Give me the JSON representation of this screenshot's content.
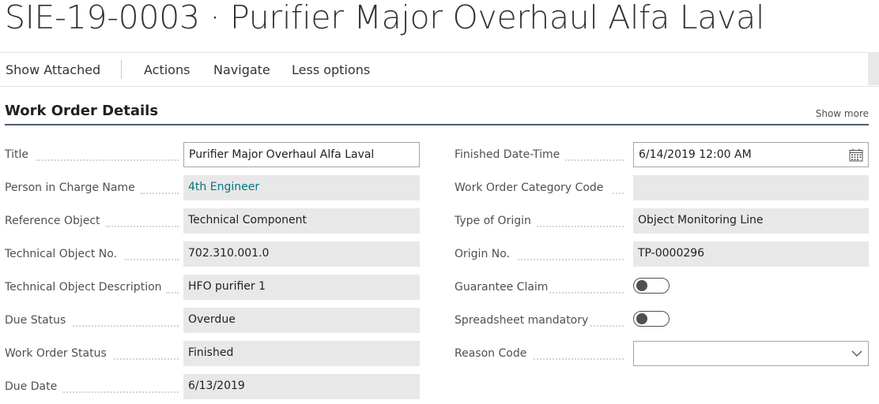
{
  "page": {
    "title": "SIE-19-0003 · Purifier Major Overhaul Alfa Laval"
  },
  "actions": {
    "show_attached": "Show Attached",
    "actions": "Actions",
    "navigate": "Navigate",
    "less_options": "Less options"
  },
  "section": {
    "title": "Work Order Details",
    "show_more": "Show more"
  },
  "left": [
    {
      "label": "Title",
      "value": "Purifier Major Overhaul Alfa Laval"
    },
    {
      "label": "Person in Charge Name",
      "value": "4th Engineer"
    },
    {
      "label": "Reference Object",
      "value": "Technical Component"
    },
    {
      "label": "Technical Object No.",
      "value": "702.310.001.0"
    },
    {
      "label": "Technical Object Description",
      "value": "HFO purifier 1"
    },
    {
      "label": "Due Status",
      "value": "Overdue"
    },
    {
      "label": "Work Order Status",
      "value": "Finished"
    },
    {
      "label": "Due Date",
      "value": "6/13/2019"
    }
  ],
  "right": [
    {
      "label": "Finished Date-Time",
      "value": "6/14/2019 12:00 AM",
      "icon": "calendar-icon"
    },
    {
      "label": "Work Order Category Code",
      "value": ""
    },
    {
      "label": "Type of Origin",
      "value": "Object Monitoring Line"
    },
    {
      "label": "Origin No.",
      "value": "TP-0000296"
    },
    {
      "label": "Guarantee Claim",
      "toggle": "off"
    },
    {
      "label": "Spreadsheet mandatory",
      "toggle": "off"
    },
    {
      "label": "Reason Code",
      "value": "",
      "icon": "chevron-down-icon"
    }
  ]
}
